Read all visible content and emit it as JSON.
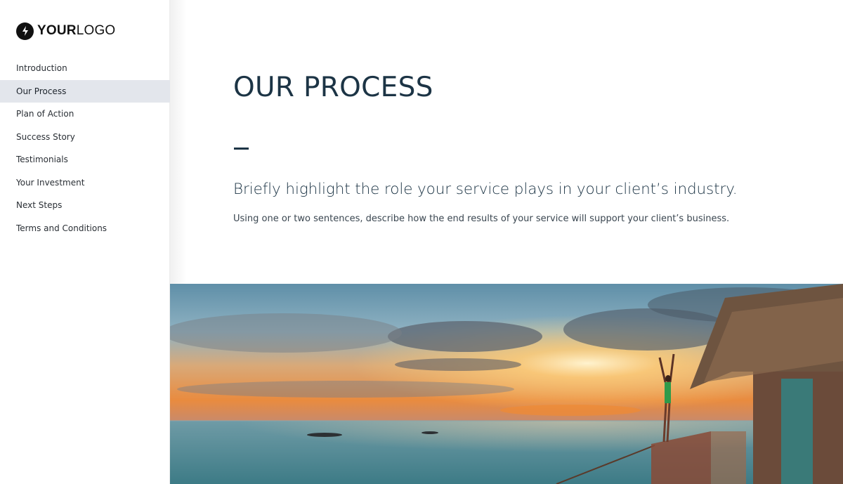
{
  "logo": {
    "icon": "lightning-bolt-icon",
    "text_bold": "YOUR",
    "text_light": "LOGO"
  },
  "sidebar": {
    "items": [
      {
        "label": "Introduction",
        "active": false
      },
      {
        "label": "Our Process",
        "active": true
      },
      {
        "label": "Plan of Action",
        "active": false
      },
      {
        "label": "Success Story",
        "active": false
      },
      {
        "label": "Testimonials",
        "active": false
      },
      {
        "label": "Your Investment",
        "active": false
      },
      {
        "label": "Next Steps",
        "active": false
      },
      {
        "label": "Terms and Conditions",
        "active": false
      }
    ]
  },
  "main": {
    "title": "OUR PROCESS",
    "lead": "Briefly highlight the role your service plays in your client’s industry.",
    "body": "Using one or two sentences, describe how the end results of your service will support your client’s business.",
    "hero_image": {
      "description": "Sunset over the ocean with a woman raising her arms on an overwater bungalow deck with a thatched roof"
    }
  },
  "colors": {
    "heading": "#1c3445",
    "active_nav_bg": "#e3e6ec",
    "logo": "#111111"
  }
}
